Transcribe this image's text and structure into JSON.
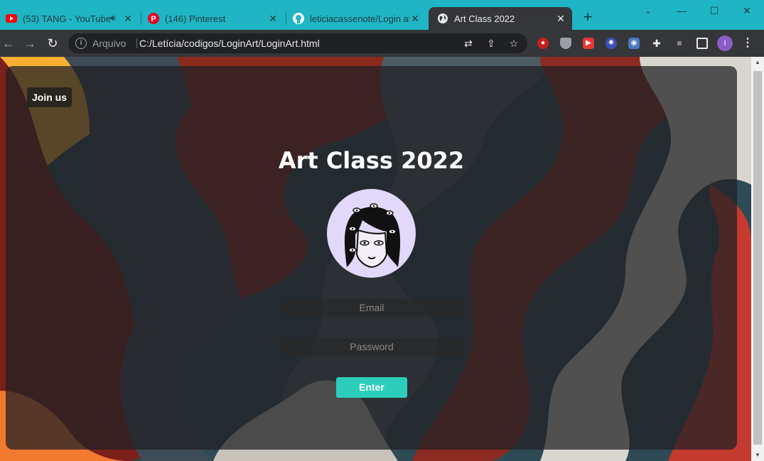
{
  "browser": {
    "tabs": [
      {
        "label": "(53) TANG - YouTube",
        "icon": "youtube-icon"
      },
      {
        "label": "(146) Pinterest",
        "icon": "pinterest-icon"
      },
      {
        "label": "leticiacassenote/Login at",
        "icon": "github-icon"
      },
      {
        "label": "Art Class 2022",
        "icon": "globe-icon",
        "active": true
      }
    ],
    "new_tab": "+",
    "address": {
      "scheme_label": "Arquivo",
      "url": "C:/Letícia/codigos/LoginArt/LoginArt.html"
    },
    "profile_initial": "I"
  },
  "page": {
    "join_label": "Join us",
    "title": "Art Class 2022",
    "email_placeholder": "Email",
    "password_placeholder": "Password",
    "enter_label": "Enter"
  },
  "colors": {
    "tab_strip": "#1fb5c4",
    "toolbar": "#35363a",
    "accent_button": "#2ccdbd",
    "avatar_bg": "#e2d8fa"
  }
}
